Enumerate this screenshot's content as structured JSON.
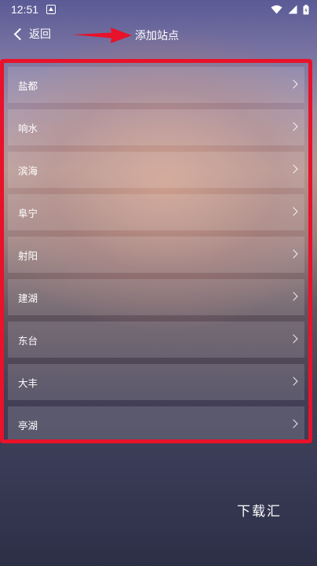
{
  "status_bar": {
    "time": "12:51"
  },
  "header": {
    "back_label": "返回",
    "title": "添加站点"
  },
  "stations": [
    {
      "name": "盐都"
    },
    {
      "name": "响水"
    },
    {
      "name": "滨海"
    },
    {
      "name": "阜宁"
    },
    {
      "name": "射阳"
    },
    {
      "name": "建湖"
    },
    {
      "name": "东台"
    },
    {
      "name": "大丰"
    },
    {
      "name": "亭湖"
    }
  ],
  "watermark": "下载汇",
  "colors": {
    "annotation_red": "#e8122a"
  }
}
